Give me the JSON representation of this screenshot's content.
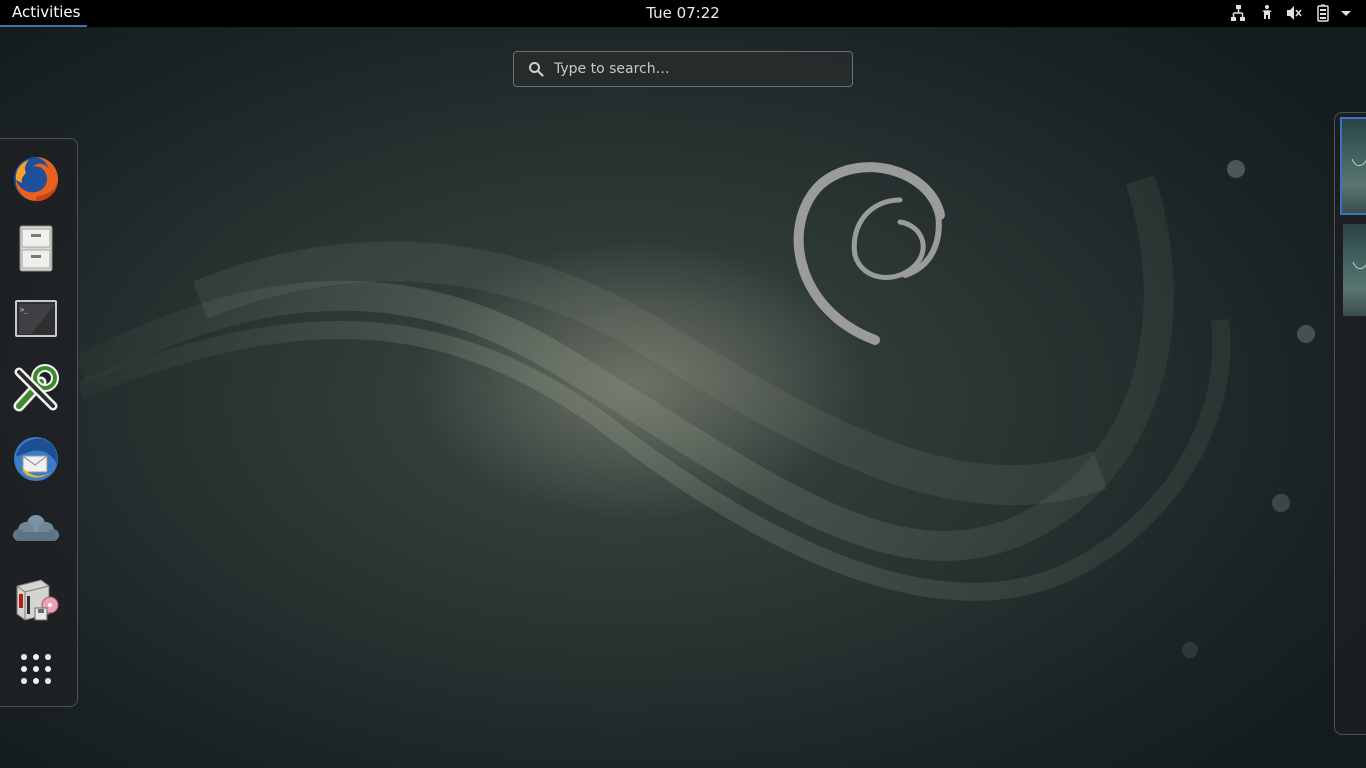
{
  "top_bar": {
    "activities_label": "Activities",
    "clock": "Tue 07:22",
    "tray_icons": [
      "network-wired-icon",
      "accessibility-icon",
      "volume-muted-icon",
      "battery-icon",
      "system-menu-arrow-icon"
    ]
  },
  "search": {
    "placeholder": "Type to search…",
    "value": ""
  },
  "dash": {
    "items": [
      {
        "name": "Firefox",
        "icon": "firefox-icon"
      },
      {
        "name": "Files",
        "icon": "file-cabinet-icon"
      },
      {
        "name": "Terminal",
        "icon": "terminal-icon"
      },
      {
        "name": "Tools",
        "icon": "tools-icon"
      },
      {
        "name": "Thunderbird",
        "icon": "thunderbird-icon"
      },
      {
        "name": "Cloud",
        "icon": "cloud-icon"
      },
      {
        "name": "Software",
        "icon": "package-installer-icon"
      },
      {
        "name": "Show Applications",
        "icon": "app-grid-icon"
      }
    ]
  },
  "workspaces": {
    "count": 2,
    "active": 1
  },
  "colors": {
    "accent": "#3b73b9",
    "top_bar": "#000000",
    "background_dark": "#1c2526"
  }
}
